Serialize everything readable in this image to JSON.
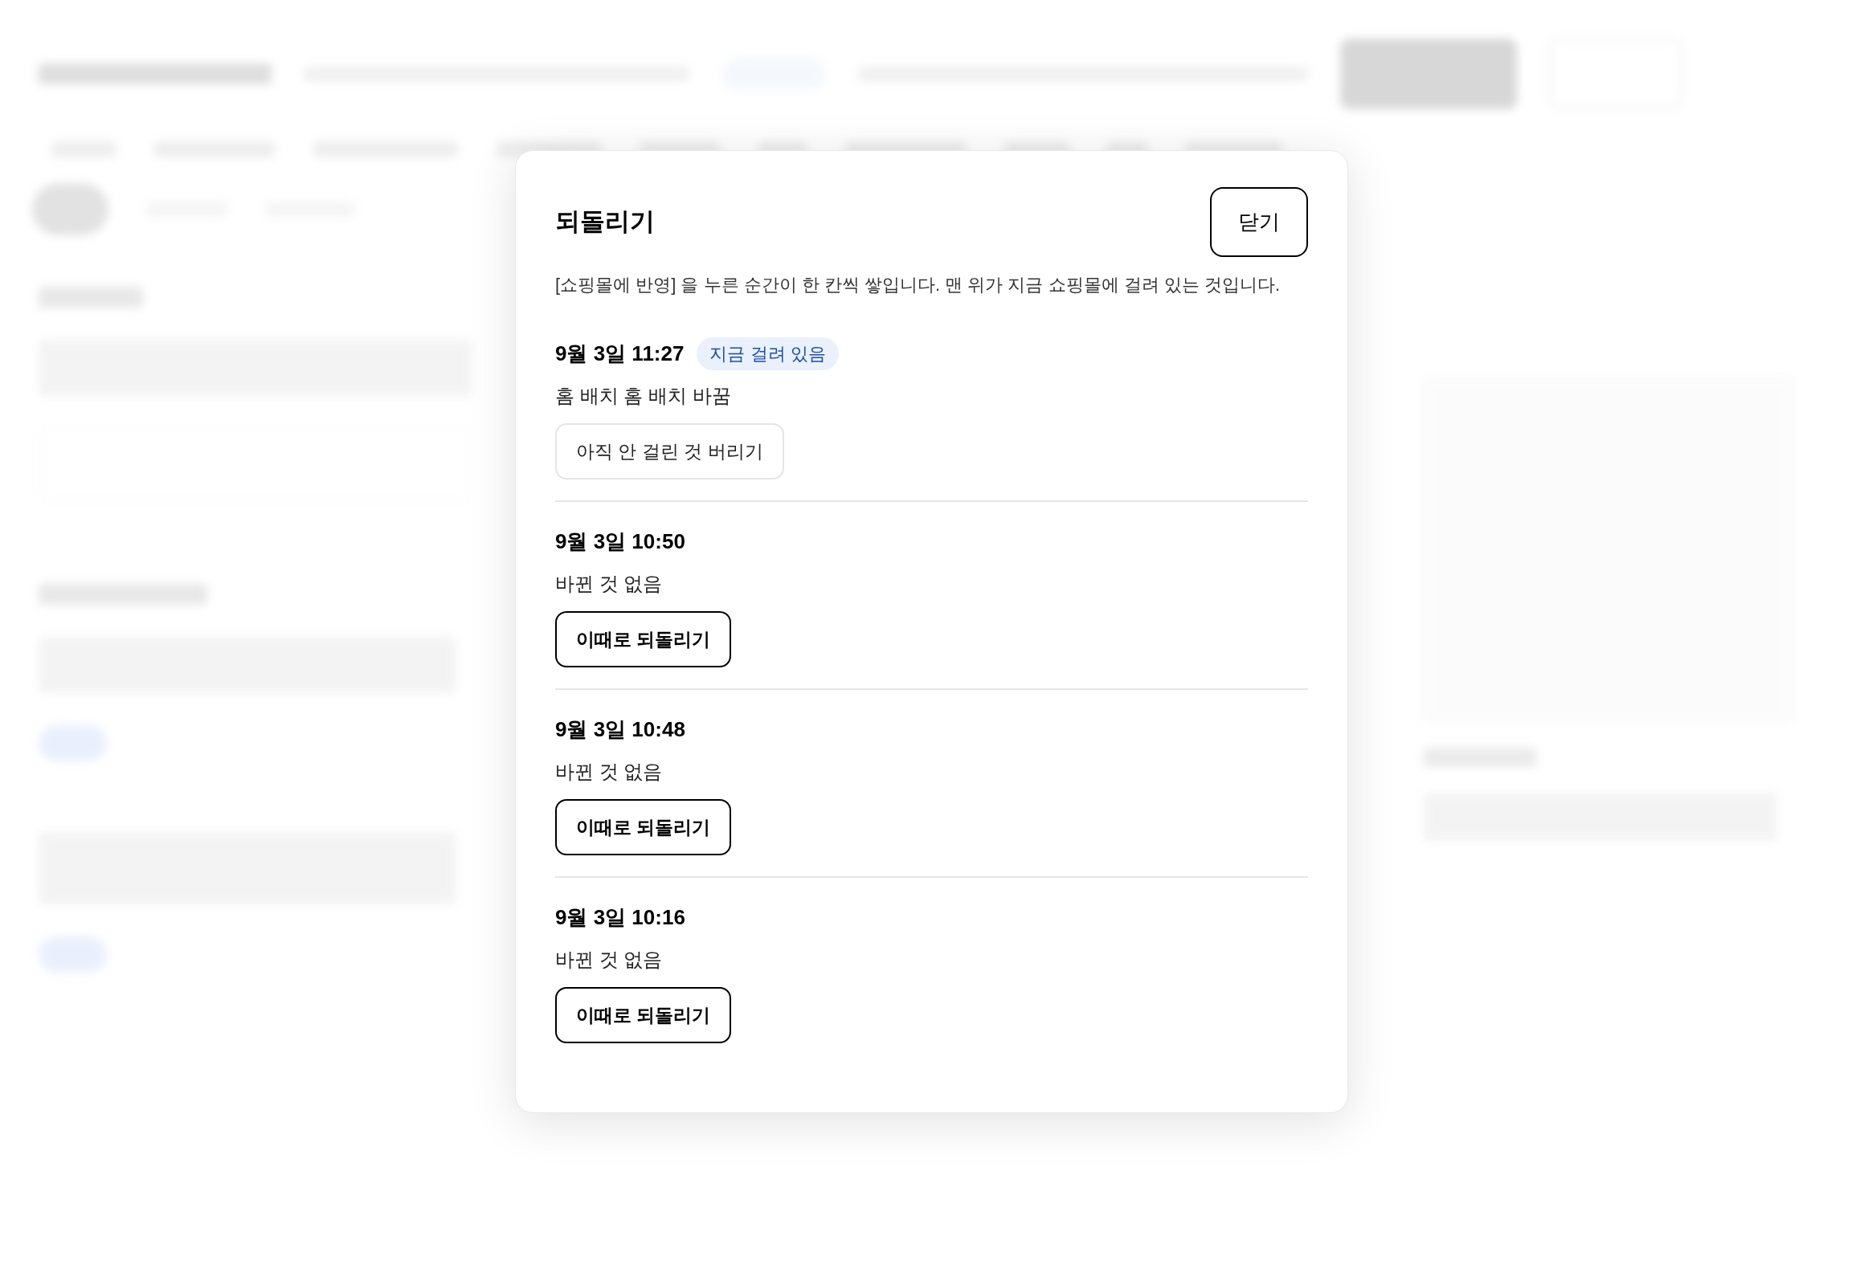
{
  "dialog": {
    "title": "되돌리기",
    "close_label": "닫기",
    "description": "[쇼핑몰에 반영] 을 누른 순간이 한 칸씩 쌓입니다. 맨 위가 지금 쇼핑몰에 걸려 있는 것입니다.",
    "entries": [
      {
        "time": "9월 3일 11:27",
        "badge": "지금 걸려 있음",
        "summary": "홈 배치 홈 배치 바꿈",
        "action": {
          "label": "아직 안 걸린 것 버리기",
          "kind": "secondary"
        }
      },
      {
        "time": "9월 3일 10:50",
        "summary": "바뀐 것 없음",
        "action": {
          "label": "이때로 되돌리기",
          "kind": "primary"
        }
      },
      {
        "time": "9월 3일 10:48",
        "summary": "바뀐 것 없음",
        "action": {
          "label": "이때로 되돌리기",
          "kind": "primary"
        }
      },
      {
        "time": "9월 3일 10:16",
        "summary": "바뀐 것 없음",
        "action": {
          "label": "이때로 되돌리기",
          "kind": "primary"
        }
      }
    ]
  }
}
